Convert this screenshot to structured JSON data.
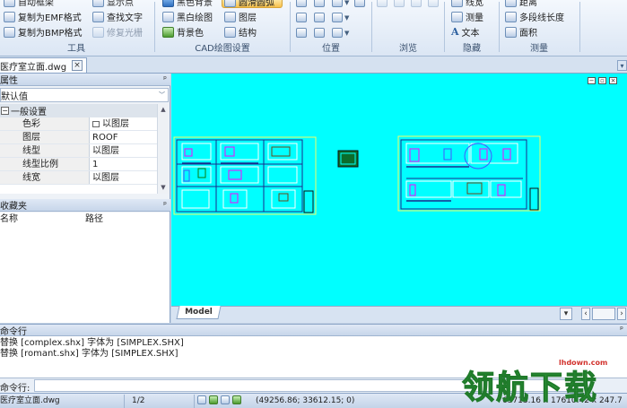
{
  "ribbon": {
    "tools_group": {
      "label": "工具",
      "items": [
        "自动框架",
        "复制为EMF格式",
        "复制为BMP格式",
        "显示点",
        "查找文字",
        "修复光栅"
      ]
    },
    "cad_group": {
      "label": "CAD绘图设置",
      "items": [
        "黑色背景",
        "黑白绘图",
        "背景色",
        "圆滑圆弧",
        "图层",
        "结构"
      ]
    },
    "position_group": {
      "label": "位置"
    },
    "browse_group": {
      "label": "浏览"
    },
    "hide_group": {
      "label": "隐藏",
      "items": [
        "线宽",
        "测量",
        "文本"
      ]
    },
    "measure_group": {
      "label": "测量",
      "items": [
        "距离",
        "多段线长度",
        "面积"
      ]
    }
  },
  "document_tab": {
    "title": "医疗室立面.dwg",
    "close": "×"
  },
  "properties_panel": {
    "title": "属性",
    "pin": "ᵖ",
    "selector_value": "默认值",
    "category": "一般设置",
    "rows": [
      {
        "key": "色彩",
        "value": "以图层",
        "swatch": true
      },
      {
        "key": "图层",
        "value": "ROOF"
      },
      {
        "key": "线型",
        "value": "以图层"
      },
      {
        "key": "线型比例",
        "value": "1"
      },
      {
        "key": "线宽",
        "value": "以图层"
      }
    ]
  },
  "favorites_panel": {
    "title": "收藏夹",
    "columns": [
      "名称",
      "路径"
    ]
  },
  "canvas": {
    "background": "#00ffff",
    "model_tab": "Model"
  },
  "command": {
    "title": "命令行",
    "history": [
      "替换 [complex.shx] 字体为 [SIMPLEX.SHX]",
      "替换 [romant.shx] 字体为 [SIMPLEX.SHX]"
    ],
    "prompt_label": "命令行:"
  },
  "status": {
    "file": "医疗室立面.dwg",
    "page": "1/2",
    "coords": "(49256.86; 33612.15; 0)",
    "dims": "63713.16 x 17610.42 x 247.7"
  },
  "watermark": {
    "text": "领航下载",
    "url": "lhdown.com"
  }
}
